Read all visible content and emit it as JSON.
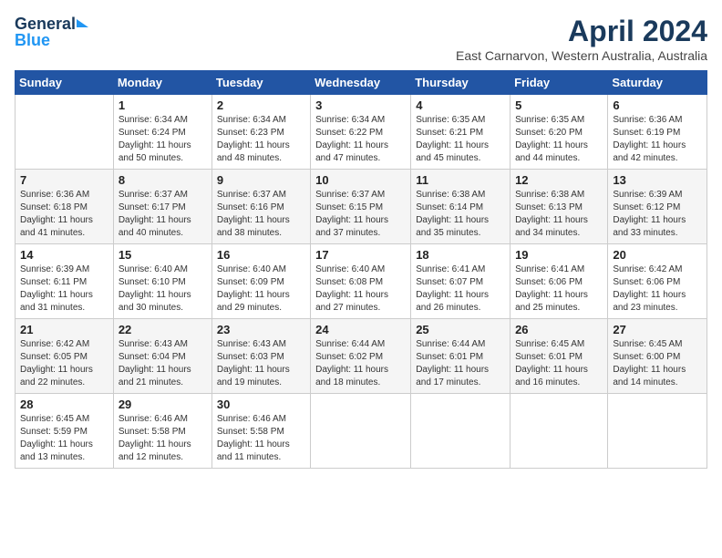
{
  "logo": {
    "line1": "General",
    "line2": "Blue"
  },
  "title": "April 2024",
  "subtitle": "East Carnarvon, Western Australia, Australia",
  "weekdays": [
    "Sunday",
    "Monday",
    "Tuesday",
    "Wednesday",
    "Thursday",
    "Friday",
    "Saturday"
  ],
  "weeks": [
    [
      {
        "day": "",
        "sunrise": "",
        "sunset": "",
        "daylight": ""
      },
      {
        "day": "1",
        "sunrise": "Sunrise: 6:34 AM",
        "sunset": "Sunset: 6:24 PM",
        "daylight": "Daylight: 11 hours and 50 minutes."
      },
      {
        "day": "2",
        "sunrise": "Sunrise: 6:34 AM",
        "sunset": "Sunset: 6:23 PM",
        "daylight": "Daylight: 11 hours and 48 minutes."
      },
      {
        "day": "3",
        "sunrise": "Sunrise: 6:34 AM",
        "sunset": "Sunset: 6:22 PM",
        "daylight": "Daylight: 11 hours and 47 minutes."
      },
      {
        "day": "4",
        "sunrise": "Sunrise: 6:35 AM",
        "sunset": "Sunset: 6:21 PM",
        "daylight": "Daylight: 11 hours and 45 minutes."
      },
      {
        "day": "5",
        "sunrise": "Sunrise: 6:35 AM",
        "sunset": "Sunset: 6:20 PM",
        "daylight": "Daylight: 11 hours and 44 minutes."
      },
      {
        "day": "6",
        "sunrise": "Sunrise: 6:36 AM",
        "sunset": "Sunset: 6:19 PM",
        "daylight": "Daylight: 11 hours and 42 minutes."
      }
    ],
    [
      {
        "day": "7",
        "sunrise": "Sunrise: 6:36 AM",
        "sunset": "Sunset: 6:18 PM",
        "daylight": "Daylight: 11 hours and 41 minutes."
      },
      {
        "day": "8",
        "sunrise": "Sunrise: 6:37 AM",
        "sunset": "Sunset: 6:17 PM",
        "daylight": "Daylight: 11 hours and 40 minutes."
      },
      {
        "day": "9",
        "sunrise": "Sunrise: 6:37 AM",
        "sunset": "Sunset: 6:16 PM",
        "daylight": "Daylight: 11 hours and 38 minutes."
      },
      {
        "day": "10",
        "sunrise": "Sunrise: 6:37 AM",
        "sunset": "Sunset: 6:15 PM",
        "daylight": "Daylight: 11 hours and 37 minutes."
      },
      {
        "day": "11",
        "sunrise": "Sunrise: 6:38 AM",
        "sunset": "Sunset: 6:14 PM",
        "daylight": "Daylight: 11 hours and 35 minutes."
      },
      {
        "day": "12",
        "sunrise": "Sunrise: 6:38 AM",
        "sunset": "Sunset: 6:13 PM",
        "daylight": "Daylight: 11 hours and 34 minutes."
      },
      {
        "day": "13",
        "sunrise": "Sunrise: 6:39 AM",
        "sunset": "Sunset: 6:12 PM",
        "daylight": "Daylight: 11 hours and 33 minutes."
      }
    ],
    [
      {
        "day": "14",
        "sunrise": "Sunrise: 6:39 AM",
        "sunset": "Sunset: 6:11 PM",
        "daylight": "Daylight: 11 hours and 31 minutes."
      },
      {
        "day": "15",
        "sunrise": "Sunrise: 6:40 AM",
        "sunset": "Sunset: 6:10 PM",
        "daylight": "Daylight: 11 hours and 30 minutes."
      },
      {
        "day": "16",
        "sunrise": "Sunrise: 6:40 AM",
        "sunset": "Sunset: 6:09 PM",
        "daylight": "Daylight: 11 hours and 29 minutes."
      },
      {
        "day": "17",
        "sunrise": "Sunrise: 6:40 AM",
        "sunset": "Sunset: 6:08 PM",
        "daylight": "Daylight: 11 hours and 27 minutes."
      },
      {
        "day": "18",
        "sunrise": "Sunrise: 6:41 AM",
        "sunset": "Sunset: 6:07 PM",
        "daylight": "Daylight: 11 hours and 26 minutes."
      },
      {
        "day": "19",
        "sunrise": "Sunrise: 6:41 AM",
        "sunset": "Sunset: 6:06 PM",
        "daylight": "Daylight: 11 hours and 25 minutes."
      },
      {
        "day": "20",
        "sunrise": "Sunrise: 6:42 AM",
        "sunset": "Sunset: 6:06 PM",
        "daylight": "Daylight: 11 hours and 23 minutes."
      }
    ],
    [
      {
        "day": "21",
        "sunrise": "Sunrise: 6:42 AM",
        "sunset": "Sunset: 6:05 PM",
        "daylight": "Daylight: 11 hours and 22 minutes."
      },
      {
        "day": "22",
        "sunrise": "Sunrise: 6:43 AM",
        "sunset": "Sunset: 6:04 PM",
        "daylight": "Daylight: 11 hours and 21 minutes."
      },
      {
        "day": "23",
        "sunrise": "Sunrise: 6:43 AM",
        "sunset": "Sunset: 6:03 PM",
        "daylight": "Daylight: 11 hours and 19 minutes."
      },
      {
        "day": "24",
        "sunrise": "Sunrise: 6:44 AM",
        "sunset": "Sunset: 6:02 PM",
        "daylight": "Daylight: 11 hours and 18 minutes."
      },
      {
        "day": "25",
        "sunrise": "Sunrise: 6:44 AM",
        "sunset": "Sunset: 6:01 PM",
        "daylight": "Daylight: 11 hours and 17 minutes."
      },
      {
        "day": "26",
        "sunrise": "Sunrise: 6:45 AM",
        "sunset": "Sunset: 6:01 PM",
        "daylight": "Daylight: 11 hours and 16 minutes."
      },
      {
        "day": "27",
        "sunrise": "Sunrise: 6:45 AM",
        "sunset": "Sunset: 6:00 PM",
        "daylight": "Daylight: 11 hours and 14 minutes."
      }
    ],
    [
      {
        "day": "28",
        "sunrise": "Sunrise: 6:45 AM",
        "sunset": "Sunset: 5:59 PM",
        "daylight": "Daylight: 11 hours and 13 minutes."
      },
      {
        "day": "29",
        "sunrise": "Sunrise: 6:46 AM",
        "sunset": "Sunset: 5:58 PM",
        "daylight": "Daylight: 11 hours and 12 minutes."
      },
      {
        "day": "30",
        "sunrise": "Sunrise: 6:46 AM",
        "sunset": "Sunset: 5:58 PM",
        "daylight": "Daylight: 11 hours and 11 minutes."
      },
      {
        "day": "",
        "sunrise": "",
        "sunset": "",
        "daylight": ""
      },
      {
        "day": "",
        "sunrise": "",
        "sunset": "",
        "daylight": ""
      },
      {
        "day": "",
        "sunrise": "",
        "sunset": "",
        "daylight": ""
      },
      {
        "day": "",
        "sunrise": "",
        "sunset": "",
        "daylight": ""
      }
    ]
  ]
}
